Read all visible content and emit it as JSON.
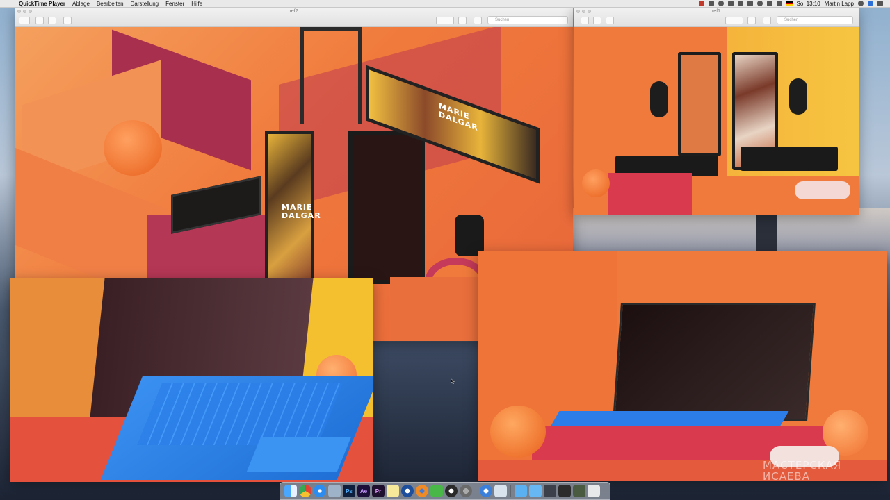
{
  "menubar": {
    "app_name": "QuickTime Player",
    "items": [
      "Ablage",
      "Bearbeiten",
      "Darstellung",
      "Fenster",
      "Hilfe"
    ],
    "clock": "So. 13:10",
    "user": "Martin Lapp"
  },
  "windows": {
    "ref2": {
      "title": "ref2",
      "search_placeholder": "Suchen"
    },
    "ref1": {
      "title": "ref1",
      "search_placeholder": "Suchen"
    }
  },
  "scene": {
    "brand_text_1": "MARIE DALGAR",
    "brand_text_2": "MARIE DALGAR",
    "watermark_line_1": "МАСТЕРСКАЯ",
    "watermark_line_2": "ИСАЕВА"
  },
  "dock": {
    "icons": [
      "finder-icon",
      "chrome-icon",
      "safari-icon",
      "preview-icon",
      "photoshop-icon",
      "after-effects-icon",
      "premiere-icon",
      "notes-icon",
      "cinema4d-icon",
      "blender-icon",
      "coda-icon",
      "quicktime-icon",
      "system-prefs-icon",
      "photos-icon",
      "folder-icon",
      "folder-icon",
      "tablet-icon",
      "downloads-icon",
      "trash-icon"
    ],
    "labels": {
      "photoshop": "Ps",
      "after_effects": "Ae",
      "premiere": "Pr"
    }
  },
  "colors": {
    "orange": "#f07a3c",
    "magenta": "#b8365a",
    "surface_blue": "#2f86e6",
    "yellow_bg": "#f5c030"
  }
}
